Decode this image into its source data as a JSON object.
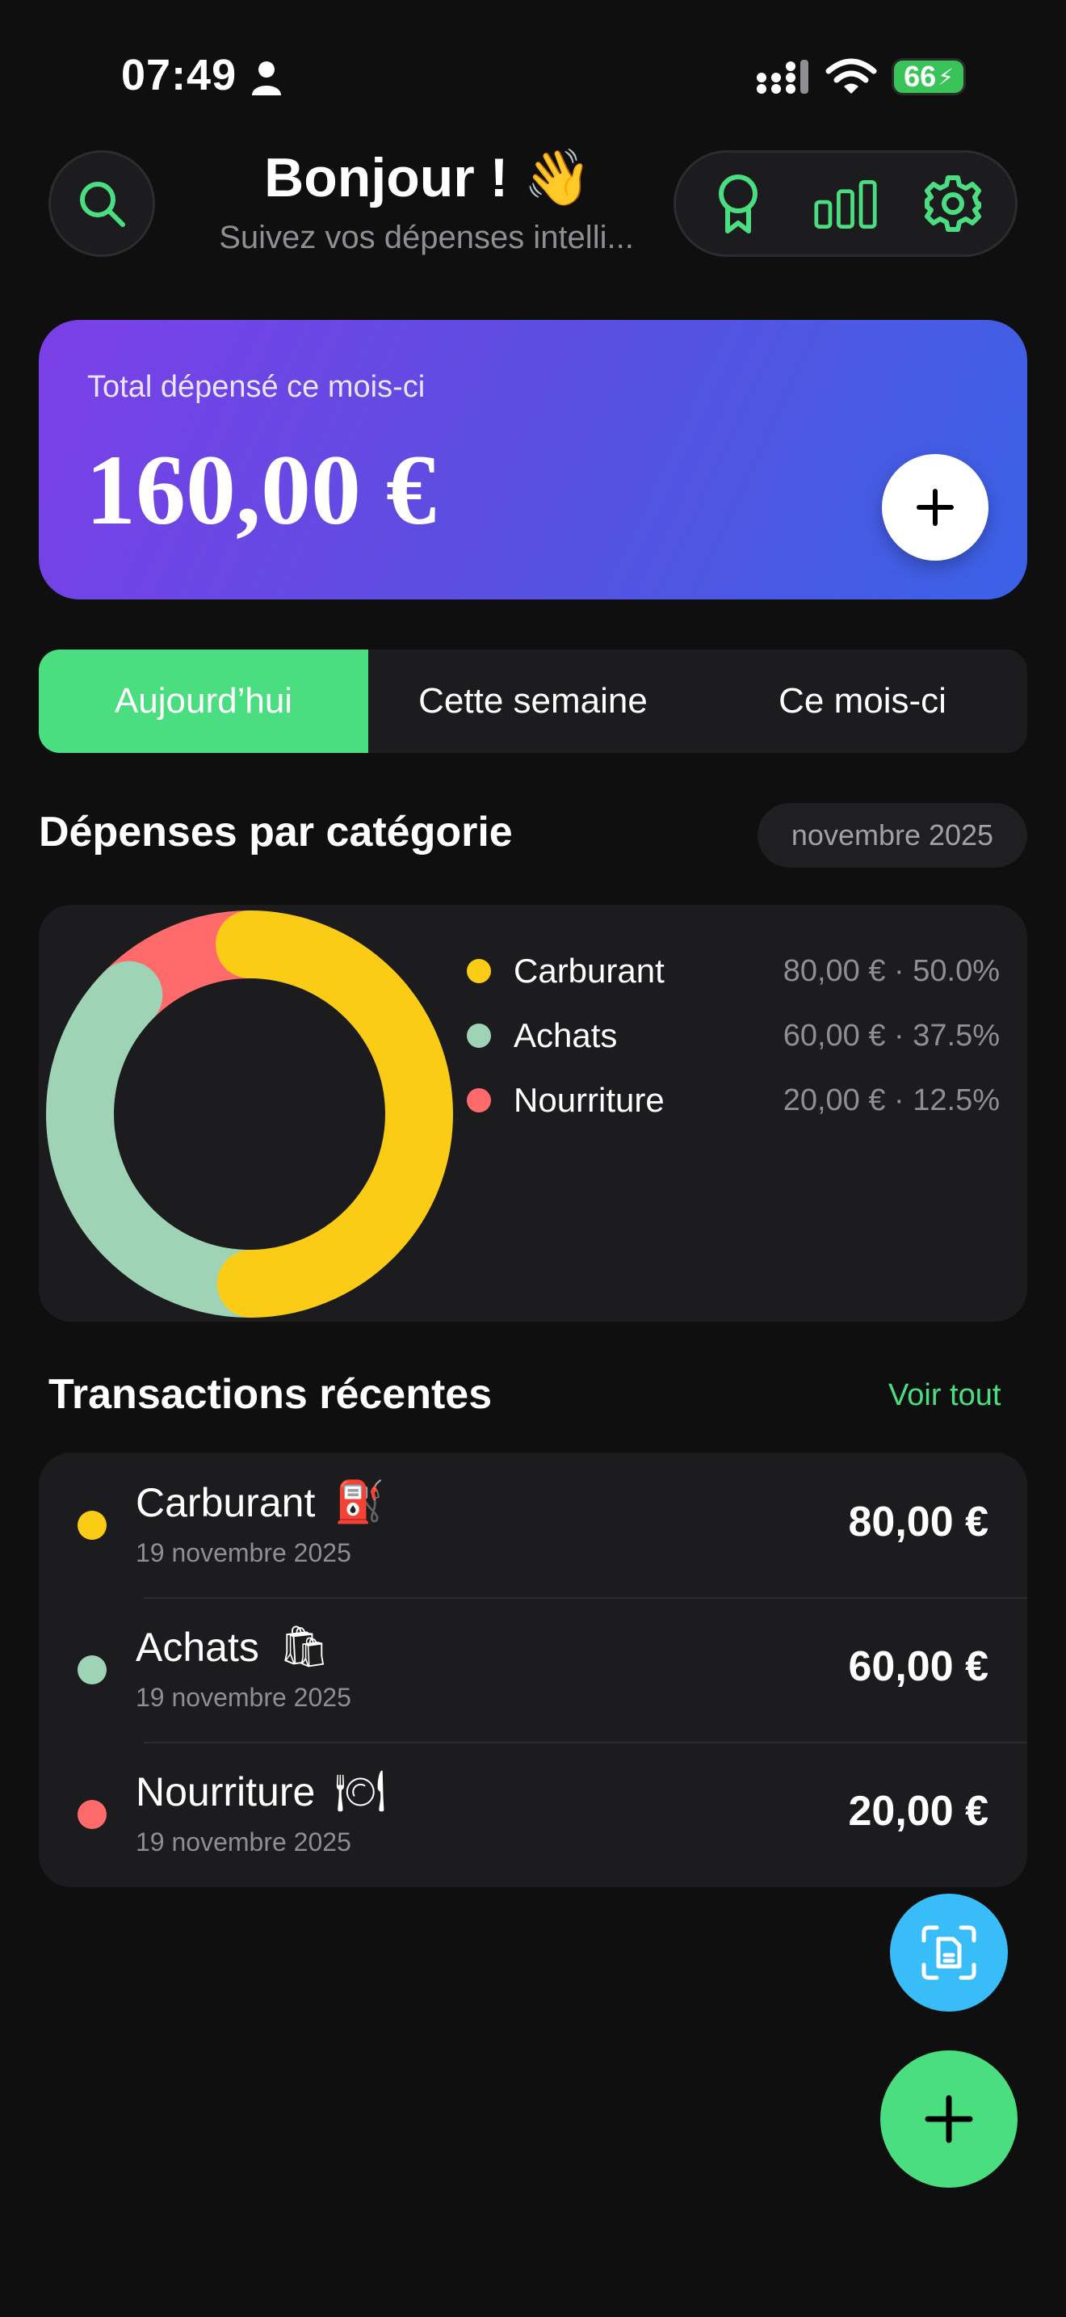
{
  "status_bar": {
    "time": "07:49",
    "battery": "66",
    "icons": [
      "person-icon",
      "signal-icon",
      "wifi-icon",
      "battery-charging-icon"
    ]
  },
  "header": {
    "greeting": "Bonjour ! 👋",
    "subtitle": "Suivez vos dépenses intelli...",
    "icons": [
      "search-icon",
      "award-ribbon-icon",
      "bar-chart-icon",
      "gear-icon"
    ]
  },
  "total_card": {
    "label": "Total dépensé ce mois-ci",
    "amount": "160,00 €"
  },
  "periods": {
    "tabs": [
      {
        "label": "Aujourd’hui",
        "active": true
      },
      {
        "label": "Cette semaine",
        "active": false
      },
      {
        "label": "Ce mois-ci",
        "active": false
      }
    ]
  },
  "categories_section": {
    "title": "Dépenses par catégorie",
    "month": "novembre 2025"
  },
  "chart_data": {
    "type": "pie",
    "categories": [
      "Carburant",
      "Achats",
      "Nourriture"
    ],
    "values": [
      80,
      60,
      20
    ],
    "percentages": [
      50.0,
      37.5,
      12.5
    ],
    "value_labels": [
      "80,00 € · 50.0%",
      "60,00 € · 37.5%",
      "20,00 € · 12.5%"
    ],
    "colors": [
      "#facc15",
      "#9ed3b6",
      "#ff6b6b"
    ],
    "legend_position": "right",
    "style": "donut"
  },
  "transactions": {
    "title": "Transactions récentes",
    "see_all": "Voir tout",
    "items": [
      {
        "name": "Carburant",
        "emoji": "⛽",
        "date": "19 novembre 2025",
        "amount": "80,00 €",
        "color": "#facc15"
      },
      {
        "name": "Achats",
        "emoji": "🛍",
        "date": "19 novembre 2025",
        "amount": "60,00 €",
        "color": "#9ed3b6"
      },
      {
        "name": "Nourriture",
        "emoji": "🍽",
        "date": "19 novembre 2025",
        "amount": "20,00 €",
        "color": "#ff6b6b"
      }
    ]
  },
  "colors": {
    "accent": "#4ade80",
    "scan": "#38bdf8",
    "card_gradient": [
      "#7b3fe8",
      "#3a62e6"
    ]
  }
}
